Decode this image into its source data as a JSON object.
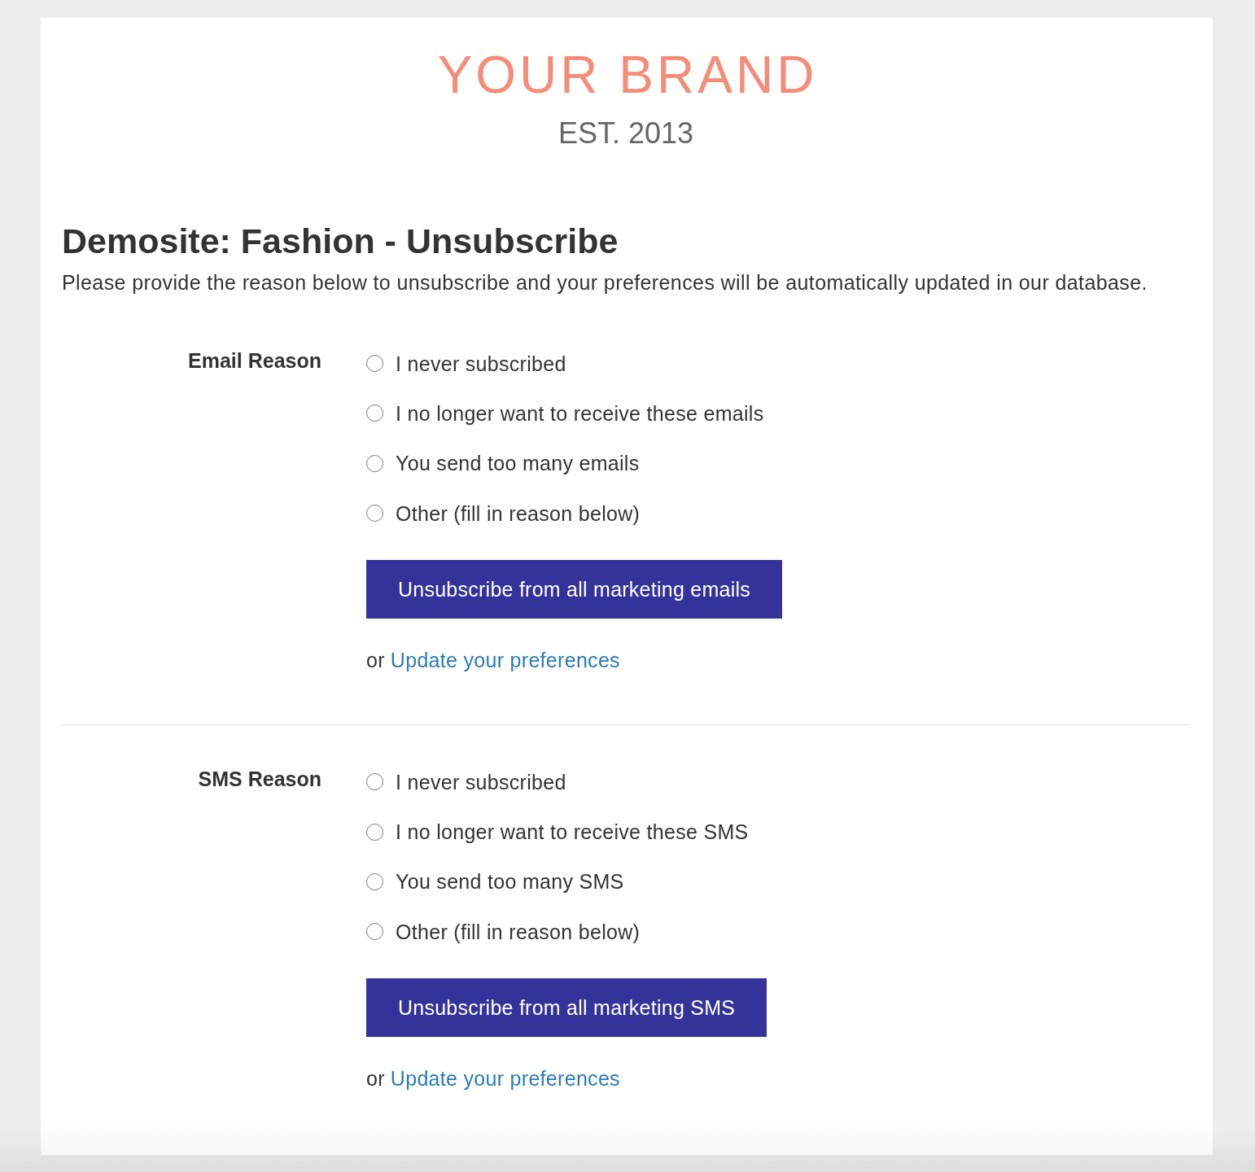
{
  "logo": {
    "brand": "YOUR BRAND",
    "tagline": "EST. 2013"
  },
  "heading": "Demosite: Fashion - Unsubscribe",
  "intro": "Please provide the reason below to unsubscribe and your preferences will be automatically updated in our database.",
  "sections": [
    {
      "label": "Email Reason",
      "options": [
        {
          "label": "I never subscribed",
          "selected": false
        },
        {
          "label": "I no longer want to receive these emails",
          "selected": false
        },
        {
          "label": "You send too many emails",
          "selected": false
        },
        {
          "label": "Other (fill in reason below)",
          "selected": false
        }
      ],
      "button": "Unsubscribe from all marketing emails",
      "alt_prefix": "or",
      "alt_link": "Update your preferences"
    },
    {
      "label": "SMS Reason",
      "options": [
        {
          "label": "I never subscribed",
          "selected": false
        },
        {
          "label": "I no longer want to receive these SMS",
          "selected": false
        },
        {
          "label": "You send too many SMS",
          "selected": false
        },
        {
          "label": "Other (fill in reason below)",
          "selected": false
        }
      ],
      "button": "Unsubscribe from all marketing SMS",
      "alt_prefix": "or",
      "alt_link": "Update your preferences"
    }
  ]
}
